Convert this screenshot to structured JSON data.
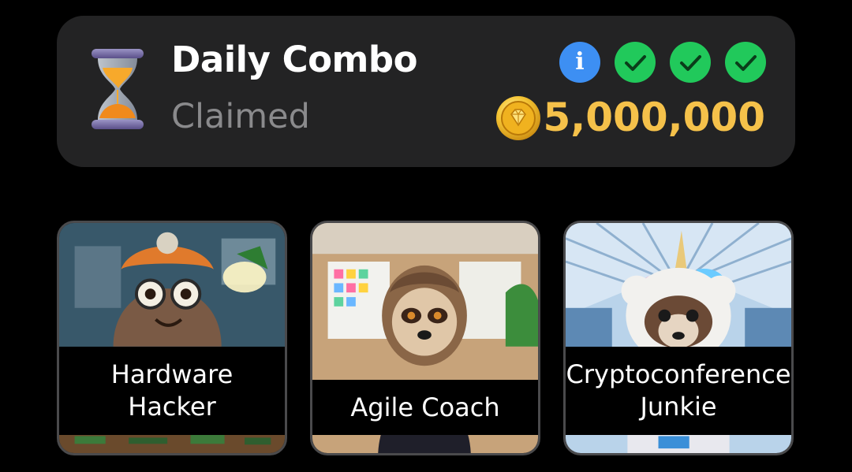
{
  "daily_combo": {
    "title": "Daily Combo",
    "status": "Claimed",
    "reward": "5,000,000",
    "icons": {
      "left": "hourglass-icon",
      "info": "info-icon",
      "checks": [
        "check-icon",
        "check-icon",
        "check-icon"
      ],
      "coin": "coin-icon"
    },
    "colors": {
      "panel": "#232324",
      "info": "#3d8ff3",
      "check": "#21c95b",
      "reward": "#f5c14a",
      "status": "#8a8a8c"
    }
  },
  "cards": [
    {
      "label": "Hardware Hacker"
    },
    {
      "label": "Agile Coach"
    },
    {
      "label": "Cryptoconference Junkie"
    }
  ]
}
